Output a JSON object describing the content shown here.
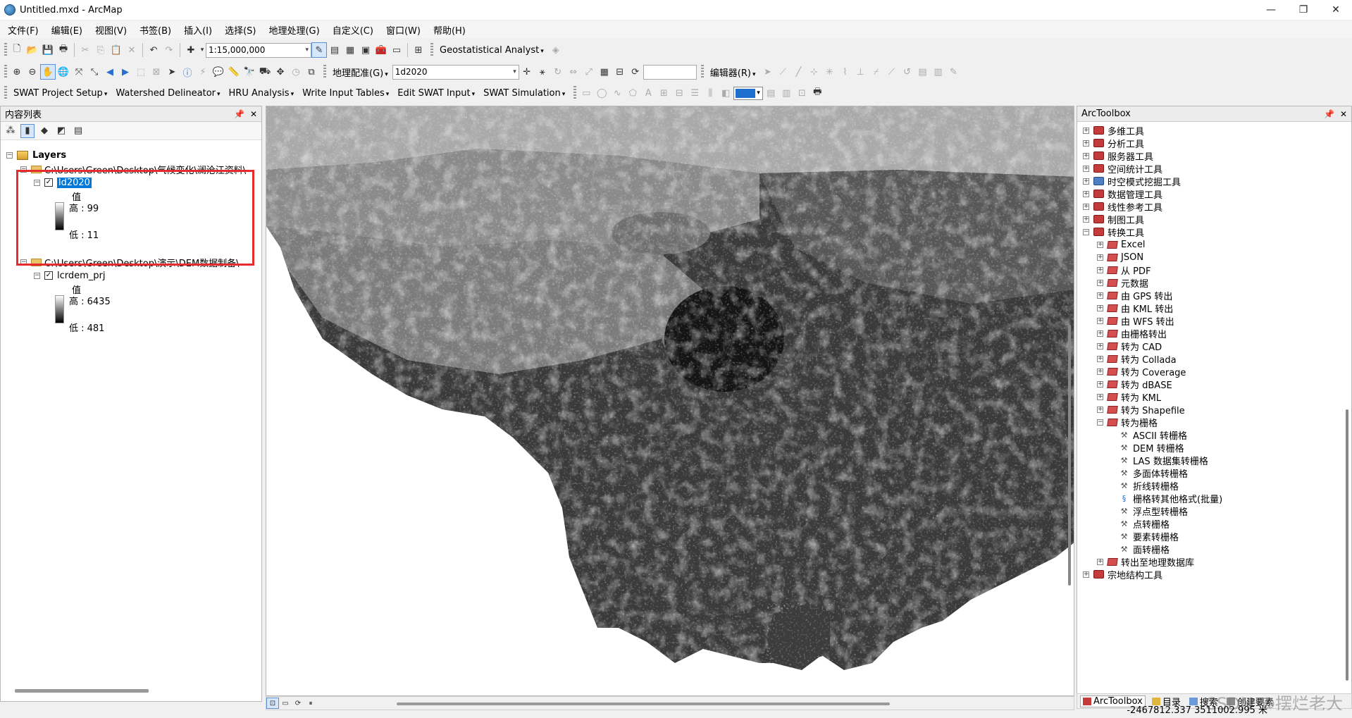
{
  "window": {
    "title": "Untitled.mxd - ArcMap",
    "minimize": "—",
    "maximize": "❐",
    "close": "✕"
  },
  "menu": [
    "文件(F)",
    "编辑(E)",
    "视图(V)",
    "书签(B)",
    "插入(I)",
    "选择(S)",
    "地理处理(G)",
    "自定义(C)",
    "窗口(W)",
    "帮助(H)"
  ],
  "toolbar1": {
    "scale": "1:15,000,000",
    "geostat": "Geostatistical Analyst"
  },
  "toolbar2": {
    "georef": "地理配准(G)",
    "layer": "1d2020",
    "editor": "编辑器(R)"
  },
  "toolbar3": [
    "SWAT Project Setup",
    "Watershed Delineator",
    "HRU Analysis",
    "Write Input Tables",
    "Edit SWAT Input",
    "SWAT Simulation"
  ],
  "toc": {
    "title": "内容列表",
    "layers_label": "Layers",
    "group1_path": "C:\\Users\\Green\\Desktop\\气候变化\\澜沧江资料\\",
    "layer1_name": "ld2020",
    "layer1_value_label": "值",
    "layer1_high": "高 : 99",
    "layer1_low": "低 : 11",
    "group2_path": "C:\\Users\\Green\\Desktop\\演示\\DEM数据制备\\",
    "layer2_name": "lcrdem_prj",
    "layer2_value_label": "值",
    "layer2_high": "高 : 6435",
    "layer2_low": "低 : 481"
  },
  "toolbox": {
    "title": "ArcToolbox",
    "top_items": [
      "多维工具",
      "分析工具",
      "服务器工具",
      "空间统计工具",
      "时空模式挖掘工具",
      "数据管理工具",
      "线性参考工具",
      "制图工具",
      "转换工具"
    ],
    "conversion_children": [
      "Excel",
      "JSON",
      "从 PDF",
      "元数据",
      "由 GPS 转出",
      "由 KML 转出",
      "由 WFS 转出",
      "由栅格转出",
      "转为 CAD",
      "转为 Collada",
      "转为 Coverage",
      "转为 dBASE",
      "转为 KML",
      "转为 Shapefile",
      "转为栅格"
    ],
    "raster_tools": [
      "ASCII 转栅格",
      "DEM 转栅格",
      "LAS 数据集转栅格",
      "多面体转栅格",
      "折线转栅格",
      "栅格转其他格式(批量)",
      "浮点型转栅格",
      "点转栅格",
      "要素转栅格",
      "面转栅格"
    ],
    "after_items": [
      "转出至地理数据库"
    ],
    "last_item": "宗地结构工具",
    "tabs": [
      "ArcToolbox",
      "目录",
      "搜索",
      "创建要素"
    ],
    "watermark": "CSDN @摆烂老大"
  },
  "status": {
    "coords": "-2467812.337  3511002.995 米"
  }
}
